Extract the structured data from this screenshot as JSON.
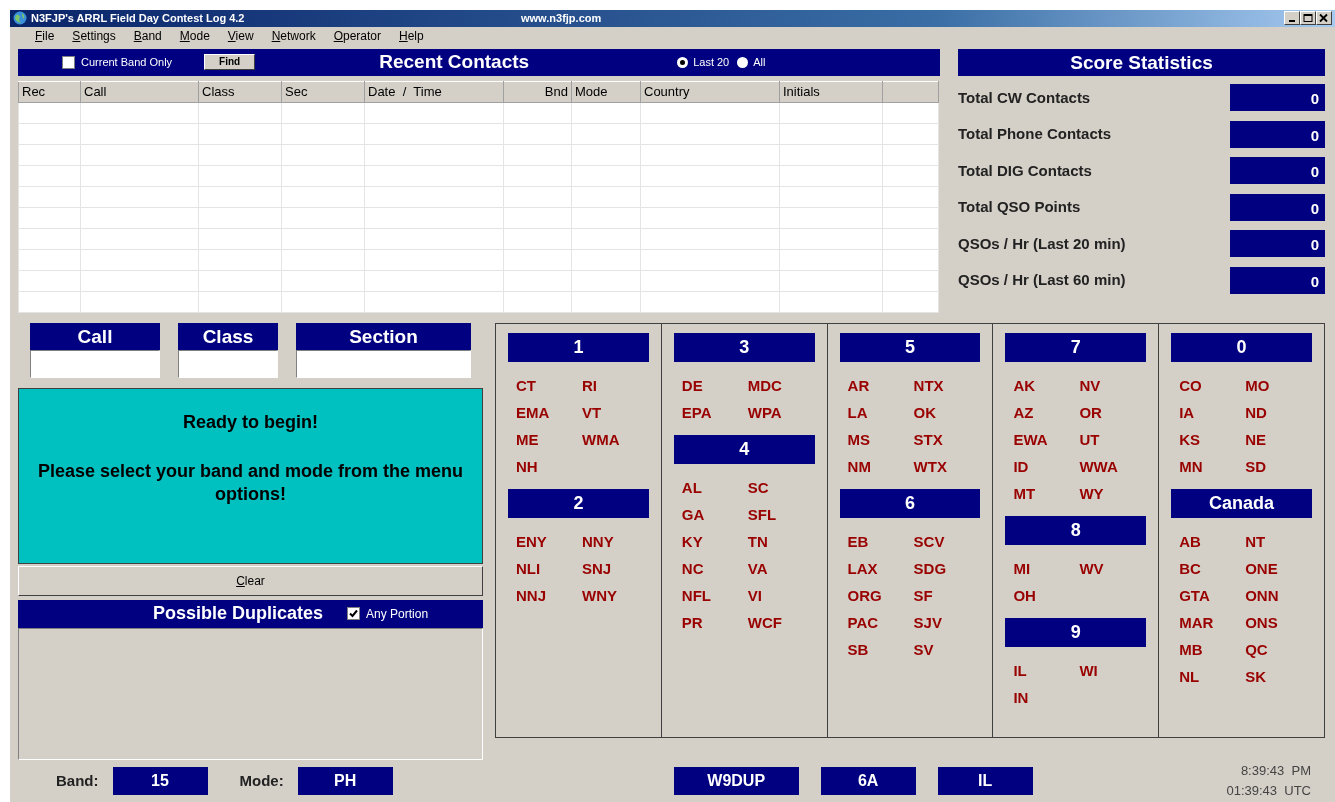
{
  "window": {
    "title": "N3FJP's ARRL Field Day Contest Log 4.2",
    "url": "www.n3fjp.com"
  },
  "menu": [
    "File",
    "Settings",
    "Band",
    "Mode",
    "View",
    "Network",
    "Operator",
    "Help"
  ],
  "recent_contacts": {
    "title": "Recent Contacts",
    "current_band_only": {
      "label": "Current Band Only",
      "checked": false
    },
    "find_button": "Find",
    "range_options": [
      {
        "label": "Last 20",
        "selected": true
      },
      {
        "label": "All",
        "selected": false
      }
    ],
    "columns": [
      "Rec",
      "Call",
      "Class",
      "Sec",
      "Date  /  Time",
      "Bnd",
      "Mode",
      "Country",
      "Initials"
    ]
  },
  "score_statistics": {
    "title": "Score Statistics",
    "rows": [
      {
        "label": "Total CW Contacts",
        "value": "0"
      },
      {
        "label": "Total Phone Contacts",
        "value": "0"
      },
      {
        "label": "Total DIG Contacts",
        "value": "0"
      },
      {
        "label": "Total QSO Points",
        "value": "0"
      },
      {
        "label": "QSOs / Hr (Last 20 min)",
        "value": "0"
      },
      {
        "label": "QSOs / Hr (Last 60 min)",
        "value": "0"
      }
    ]
  },
  "entry_fields": [
    {
      "label": "Call"
    },
    {
      "label": "Class"
    },
    {
      "label": "Section"
    }
  ],
  "message": [
    "Ready to begin!",
    "Please select your band and mode from the menu options!"
  ],
  "clear_button": "Clear",
  "duplicates": {
    "title": "Possible Duplicates",
    "any_portion": {
      "label": "Any Portion",
      "checked": true
    }
  },
  "section_columns": [
    {
      "blocks": [
        {
          "title": "1",
          "sections": [
            "CT",
            "RI",
            "EMA",
            "VT",
            "ME",
            "WMA",
            "NH"
          ]
        },
        {
          "title": "2",
          "sections": [
            "ENY",
            "NNY",
            "NLI",
            "SNJ",
            "NNJ",
            "WNY"
          ]
        }
      ]
    },
    {
      "blocks": [
        {
          "title": "3",
          "sections": [
            "DE",
            "MDC",
            "EPA",
            "WPA"
          ]
        },
        {
          "title": "4",
          "sections": [
            "AL",
            "SC",
            "GA",
            "SFL",
            "KY",
            "TN",
            "NC",
            "VA",
            "NFL",
            "VI",
            "PR",
            "WCF"
          ]
        }
      ]
    },
    {
      "blocks": [
        {
          "title": "5",
          "sections": [
            "AR",
            "NTX",
            "LA",
            "OK",
            "MS",
            "STX",
            "NM",
            "WTX"
          ]
        },
        {
          "title": "6",
          "sections": [
            "EB",
            "SCV",
            "LAX",
            "SDG",
            "ORG",
            "SF",
            "PAC",
            "SJV",
            "SB",
            "SV"
          ]
        }
      ]
    },
    {
      "blocks": [
        {
          "title": "7",
          "sections": [
            "AK",
            "NV",
            "AZ",
            "OR",
            "EWA",
            "UT",
            "ID",
            "WWA",
            "MT",
            "WY"
          ]
        },
        {
          "title": "8",
          "sections": [
            "MI",
            "WV",
            "OH"
          ]
        },
        {
          "title": "9",
          "sections": [
            "IL",
            "WI",
            "IN"
          ]
        }
      ]
    },
    {
      "blocks": [
        {
          "title": "0",
          "sections": [
            "CO",
            "MO",
            "IA",
            "ND",
            "KS",
            "NE",
            "MN",
            "SD"
          ]
        },
        {
          "title": "Canada",
          "sections": [
            "AB",
            "NT",
            "BC",
            "ONE",
            "GTA",
            "ONN",
            "MAR",
            "ONS",
            "MB",
            "QC",
            "NL",
            "SK"
          ]
        }
      ]
    }
  ],
  "status_bar": {
    "band_label": "Band:",
    "band": "15",
    "mode_label": "Mode:",
    "mode": "PH",
    "call": "W9DUP",
    "class": "6A",
    "section": "IL",
    "local_time": "8:39:43  PM",
    "utc_time": "01:39:43  UTC"
  }
}
